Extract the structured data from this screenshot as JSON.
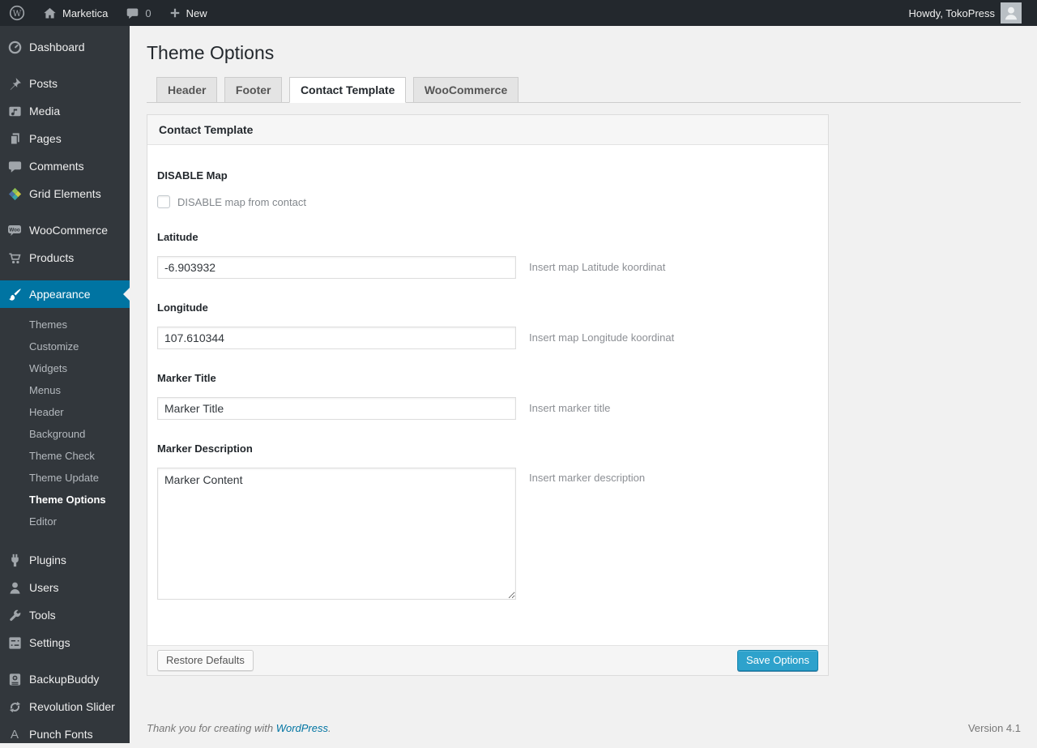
{
  "admin_bar": {
    "site_name": "Marketica",
    "comments_count": "0",
    "new_label": "New",
    "howdy_text": "Howdy, TokoPress"
  },
  "sidebar": {
    "items": [
      {
        "label": "Dashboard",
        "icon": "dashboard-icon"
      },
      {
        "label": "Posts",
        "icon": "pushpin-icon"
      },
      {
        "label": "Media",
        "icon": "media-icon"
      },
      {
        "label": "Pages",
        "icon": "pages-icon"
      },
      {
        "label": "Comments",
        "icon": "comment-icon"
      },
      {
        "label": "Grid Elements",
        "icon": "grid-elements-icon"
      },
      {
        "label": "WooCommerce",
        "icon": "woocommerce-icon"
      },
      {
        "label": "Products",
        "icon": "cart-icon"
      },
      {
        "label": "Appearance",
        "icon": "paintbrush-icon",
        "current": true
      },
      {
        "label": "Plugins",
        "icon": "plugin-icon"
      },
      {
        "label": "Users",
        "icon": "user-icon"
      },
      {
        "label": "Tools",
        "icon": "wrench-icon"
      },
      {
        "label": "Settings",
        "icon": "settings-icon"
      },
      {
        "label": "BackupBuddy",
        "icon": "backup-icon"
      },
      {
        "label": "Revolution Slider",
        "icon": "refresh-icon"
      },
      {
        "label": "Punch Fonts",
        "icon": "letter-a-icon"
      }
    ],
    "appearance_submenu": [
      {
        "label": "Themes"
      },
      {
        "label": "Customize"
      },
      {
        "label": "Widgets"
      },
      {
        "label": "Menus"
      },
      {
        "label": "Header"
      },
      {
        "label": "Background"
      },
      {
        "label": "Theme Check"
      },
      {
        "label": "Theme Update"
      },
      {
        "label": "Theme Options",
        "current": true
      },
      {
        "label": "Editor"
      }
    ]
  },
  "main": {
    "page_title": "Theme Options",
    "tabs": [
      {
        "label": "Header",
        "active": false
      },
      {
        "label": "Footer",
        "active": false
      },
      {
        "label": "Contact Template",
        "active": true
      },
      {
        "label": "WooCommerce",
        "active": false
      }
    ],
    "panel": {
      "title": "Contact Template",
      "fields": {
        "disable_map": {
          "label": "DISABLE Map",
          "checkbox_label": "DISABLE map from contact",
          "checked": false
        },
        "latitude": {
          "label": "Latitude",
          "value": "-6.903932",
          "hint": "Insert map Latitude koordinat"
        },
        "longitude": {
          "label": "Longitude",
          "value": "107.610344",
          "hint": "Insert map Longitude koordinat"
        },
        "marker_title": {
          "label": "Marker Title",
          "value": "Marker Title",
          "hint": "Insert marker title"
        },
        "marker_description": {
          "label": "Marker Description",
          "value": "Marker Content",
          "hint": "Insert marker description"
        }
      },
      "buttons": {
        "restore": "Restore Defaults",
        "save": "Save Options"
      }
    },
    "footer": {
      "thanks_prefix": "Thank you for creating with ",
      "wordpress_link": "WordPress",
      "thanks_suffix": ".",
      "version": "Version 4.1"
    }
  },
  "colors": {
    "accent": "#0074a2",
    "primary_button": "#2ea2cc",
    "admin_bar_bg": "#23282d",
    "sidebar_bg": "#32373c",
    "content_bg": "#f1f1f1"
  }
}
